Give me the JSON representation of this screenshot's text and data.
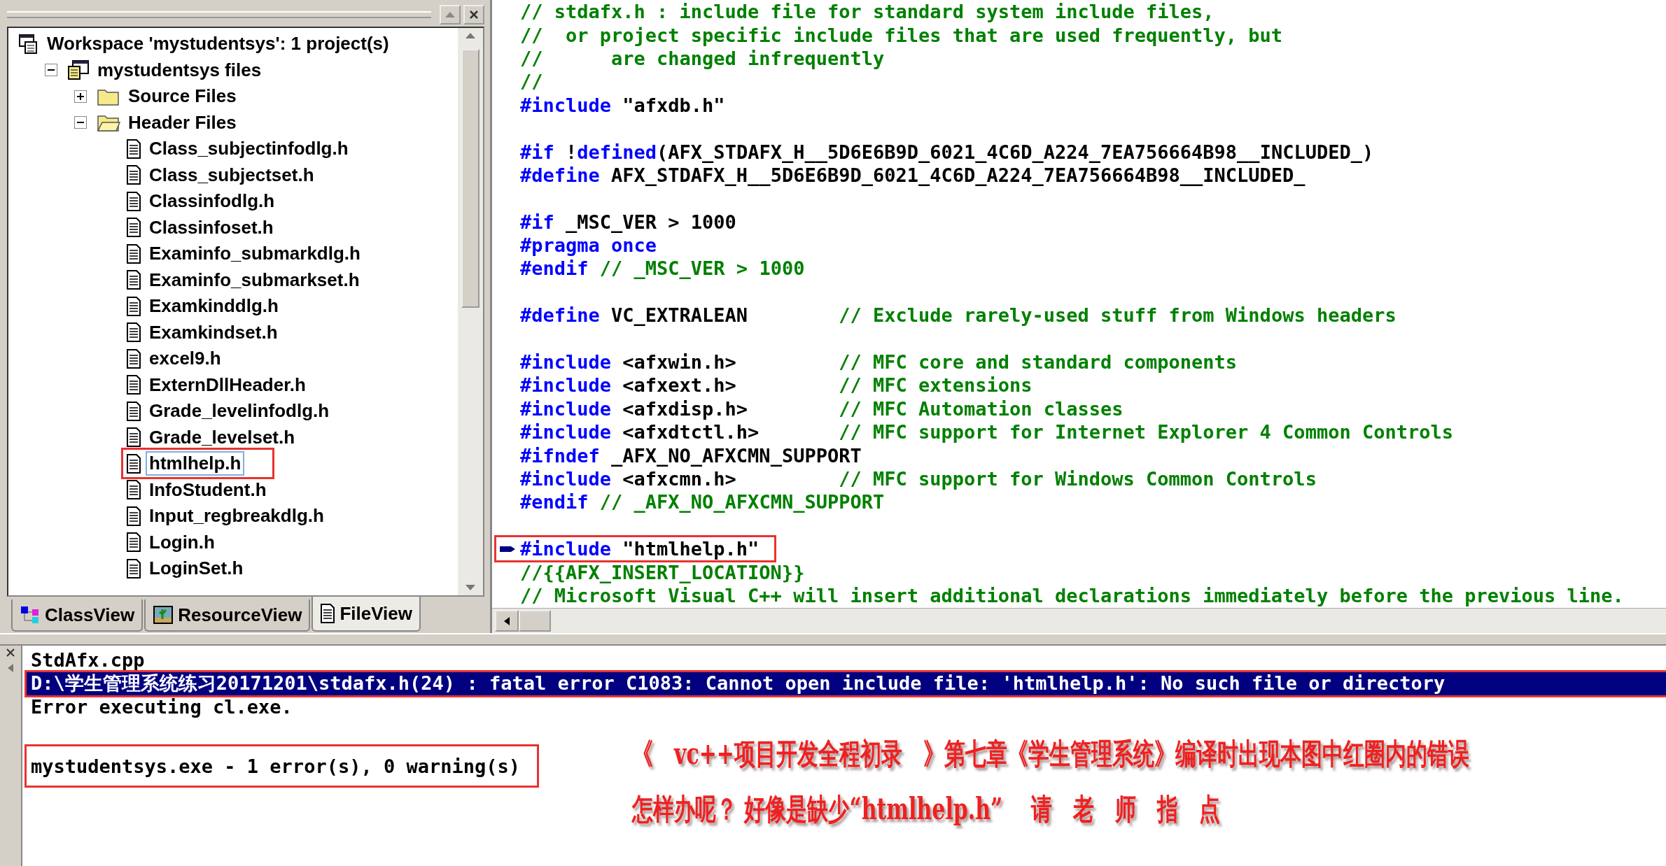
{
  "workspace": {
    "tree": [
      {
        "kind": "workspace",
        "label": "Workspace 'mystudentsys': 1 project(s)",
        "selected": false,
        "boxed": false,
        "children": [
          {
            "kind": "project",
            "label": "mystudentsys files",
            "expanded": true,
            "selected": false,
            "boxed": false,
            "children": [
              {
                "kind": "folder",
                "label": "Source Files",
                "expanded": false,
                "selected": false,
                "boxed": false
              },
              {
                "kind": "folder",
                "label": "Header Files",
                "expanded": true,
                "selected": false,
                "boxed": false,
                "children": [
                  {
                    "kind": "file",
                    "label": "Class_subjectinfodlg.h",
                    "selected": false,
                    "boxed": false
                  },
                  {
                    "kind": "file",
                    "label": "Class_subjectset.h",
                    "selected": false,
                    "boxed": false
                  },
                  {
                    "kind": "file",
                    "label": "Classinfodlg.h",
                    "selected": false,
                    "boxed": false
                  },
                  {
                    "kind": "file",
                    "label": "Classinfoset.h",
                    "selected": false,
                    "boxed": false
                  },
                  {
                    "kind": "file",
                    "label": "Examinfo_submarkdlg.h",
                    "selected": false,
                    "boxed": false
                  },
                  {
                    "kind": "file",
                    "label": "Examinfo_submarkset.h",
                    "selected": false,
                    "boxed": false
                  },
                  {
                    "kind": "file",
                    "label": "Examkinddlg.h",
                    "selected": false,
                    "boxed": false
                  },
                  {
                    "kind": "file",
                    "label": "Examkindset.h",
                    "selected": false,
                    "boxed": false
                  },
                  {
                    "kind": "file",
                    "label": "excel9.h",
                    "selected": false,
                    "boxed": false
                  },
                  {
                    "kind": "file",
                    "label": "ExternDllHeader.h",
                    "selected": false,
                    "boxed": false
                  },
                  {
                    "kind": "file",
                    "label": "Grade_levelinfodlg.h",
                    "selected": false,
                    "boxed": false
                  },
                  {
                    "kind": "file",
                    "label": "Grade_levelset.h",
                    "selected": false,
                    "boxed": false
                  },
                  {
                    "kind": "file",
                    "label": "htmlhelp.h",
                    "selected": true,
                    "boxed": true
                  },
                  {
                    "kind": "file",
                    "label": "InfoStudent.h",
                    "selected": false,
                    "boxed": false
                  },
                  {
                    "kind": "file",
                    "label": "Input_regbreakdlg.h",
                    "selected": false,
                    "boxed": false
                  },
                  {
                    "kind": "file",
                    "label": "Login.h",
                    "selected": false,
                    "boxed": false
                  },
                  {
                    "kind": "file",
                    "label": "LoginSet.h",
                    "selected": false,
                    "boxed": false
                  }
                ]
              }
            ]
          }
        ]
      }
    ],
    "tabs": [
      {
        "label": "ClassView",
        "kind": "class",
        "selected": false
      },
      {
        "label": "ResourceView",
        "kind": "resource",
        "selected": false
      },
      {
        "label": "FileView",
        "kind": "file",
        "selected": true
      }
    ]
  },
  "editor": {
    "lines": [
      {
        "kind": "code",
        "current": false,
        "boxed": false,
        "segments": [
          {
            "kind": "comment",
            "text": "// stdafx.h : include file for standard system include files,"
          }
        ]
      },
      {
        "kind": "code",
        "current": false,
        "boxed": false,
        "segments": [
          {
            "kind": "comment",
            "text": "//  or project specific include files that are used frequently, but"
          }
        ]
      },
      {
        "kind": "code",
        "current": false,
        "boxed": false,
        "segments": [
          {
            "kind": "comment",
            "text": "//      are changed infrequently"
          }
        ]
      },
      {
        "kind": "code",
        "current": false,
        "boxed": false,
        "segments": [
          {
            "kind": "comment",
            "text": "//"
          }
        ]
      },
      {
        "kind": "code",
        "current": false,
        "boxed": false,
        "segments": [
          {
            "kind": "keyword",
            "text": "#include"
          },
          {
            "kind": "plain",
            "text": " \"afxdb.h\""
          }
        ]
      },
      {
        "kind": "blank"
      },
      {
        "kind": "code",
        "current": false,
        "boxed": false,
        "segments": [
          {
            "kind": "keyword",
            "text": "#if"
          },
          {
            "kind": "plain",
            "text": " !"
          },
          {
            "kind": "keyword",
            "text": "defined"
          },
          {
            "kind": "plain",
            "text": "(AFX_STDAFX_H__5D6E6B9D_6021_4C6D_A224_7EA756664B98__INCLUDED_)"
          }
        ]
      },
      {
        "kind": "code",
        "current": false,
        "boxed": false,
        "segments": [
          {
            "kind": "keyword",
            "text": "#define"
          },
          {
            "kind": "plain",
            "text": " AFX_STDAFX_H__5D6E6B9D_6021_4C6D_A224_7EA756664B98__INCLUDED_"
          }
        ]
      },
      {
        "kind": "blank"
      },
      {
        "kind": "code",
        "current": false,
        "boxed": false,
        "segments": [
          {
            "kind": "keyword",
            "text": "#if"
          },
          {
            "kind": "plain",
            "text": " _MSC_VER > 1000"
          }
        ]
      },
      {
        "kind": "code",
        "current": false,
        "boxed": false,
        "segments": [
          {
            "kind": "keyword",
            "text": "#pragma once"
          }
        ]
      },
      {
        "kind": "code",
        "current": false,
        "boxed": false,
        "segments": [
          {
            "kind": "keyword",
            "text": "#endif"
          },
          {
            "kind": "comment",
            "text": " // _MSC_VER > 1000"
          }
        ]
      },
      {
        "kind": "blank"
      },
      {
        "kind": "code",
        "current": false,
        "boxed": false,
        "segments": [
          {
            "kind": "keyword",
            "text": "#define"
          },
          {
            "kind": "plain",
            "text": " VC_EXTRALEAN        "
          },
          {
            "kind": "comment",
            "text": "// Exclude rarely-used stuff from Windows headers"
          }
        ]
      },
      {
        "kind": "blank"
      },
      {
        "kind": "code",
        "current": false,
        "boxed": false,
        "segments": [
          {
            "kind": "keyword",
            "text": "#include"
          },
          {
            "kind": "plain",
            "text": " <afxwin.h>         "
          },
          {
            "kind": "comment",
            "text": "// MFC core and standard components"
          }
        ]
      },
      {
        "kind": "code",
        "current": false,
        "boxed": false,
        "segments": [
          {
            "kind": "keyword",
            "text": "#include"
          },
          {
            "kind": "plain",
            "text": " <afxext.h>         "
          },
          {
            "kind": "comment",
            "text": "// MFC extensions"
          }
        ]
      },
      {
        "kind": "code",
        "current": false,
        "boxed": false,
        "segments": [
          {
            "kind": "keyword",
            "text": "#include"
          },
          {
            "kind": "plain",
            "text": " <afxdisp.h>        "
          },
          {
            "kind": "comment",
            "text": "// MFC Automation classes"
          }
        ]
      },
      {
        "kind": "code",
        "current": false,
        "boxed": false,
        "segments": [
          {
            "kind": "keyword",
            "text": "#include"
          },
          {
            "kind": "plain",
            "text": " <afxdtctl.h>       "
          },
          {
            "kind": "comment",
            "text": "// MFC support for Internet Explorer 4 Common Controls"
          }
        ]
      },
      {
        "kind": "code",
        "current": false,
        "boxed": false,
        "segments": [
          {
            "kind": "keyword",
            "text": "#ifndef"
          },
          {
            "kind": "plain",
            "text": " _AFX_NO_AFXCMN_SUPPORT"
          }
        ]
      },
      {
        "kind": "code",
        "current": false,
        "boxed": false,
        "segments": [
          {
            "kind": "keyword",
            "text": "#include"
          },
          {
            "kind": "plain",
            "text": " <afxcmn.h>         "
          },
          {
            "kind": "comment",
            "text": "// MFC support for Windows Common Controls"
          }
        ]
      },
      {
        "kind": "code",
        "current": false,
        "boxed": false,
        "segments": [
          {
            "kind": "keyword",
            "text": "#endif"
          },
          {
            "kind": "comment",
            "text": " // _AFX_NO_AFXCMN_SUPPORT"
          }
        ]
      },
      {
        "kind": "blank"
      },
      {
        "kind": "code",
        "current": true,
        "boxed": true,
        "segments": [
          {
            "kind": "keyword",
            "text": "#include"
          },
          {
            "kind": "plain",
            "text": " \"htmlhelp.h\""
          }
        ]
      },
      {
        "kind": "code",
        "current": false,
        "boxed": false,
        "segments": [
          {
            "kind": "comment",
            "text": "//{{AFX_INSERT_LOCATION}}"
          }
        ]
      },
      {
        "kind": "code",
        "current": false,
        "boxed": false,
        "segments": [
          {
            "kind": "comment",
            "text": "// Microsoft Visual C++ will insert additional declarations immediately before the previous line."
          }
        ]
      }
    ]
  },
  "output": {
    "lines": [
      {
        "kind": "text",
        "text": "StdAfx.cpp",
        "selected": false,
        "boxed": false
      },
      {
        "kind": "text",
        "text": "D:\\学生管理系统练习20171201\\stdafx.h(24) : fatal error C1083: Cannot open include file: 'htmlhelp.h': No such file or directory",
        "selected": true,
        "boxed": true
      },
      {
        "kind": "text",
        "text": "Error executing cl.exe.",
        "selected": false,
        "boxed": false
      },
      {
        "kind": "blank"
      },
      {
        "kind": "text",
        "text": "mystudentsys.exe - 1 error(s), 0 warning(s)",
        "selected": false,
        "boxed": true
      }
    ]
  },
  "annotation": {
    "lines": [
      "《　vc++项目开发全程初录　》第七章《学生管理系统》编译时出现本图中红圈内的错误",
      "怎样办呢？ 好像是缺少“htmlhelp.h”　 请　老　师　指　点"
    ]
  }
}
